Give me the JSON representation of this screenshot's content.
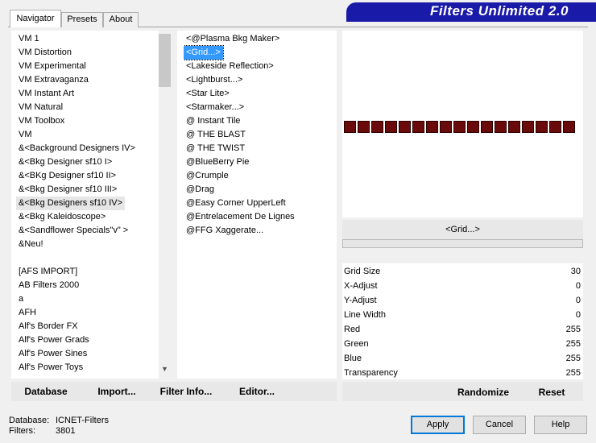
{
  "app": {
    "title": "Filters Unlimited 2.0"
  },
  "tabs": [
    {
      "label": "Navigator"
    },
    {
      "label": "Presets"
    },
    {
      "label": "About"
    }
  ],
  "categories": [
    "VM 1",
    "VM Distortion",
    "VM Experimental",
    "VM Extravaganza",
    "VM Instant Art",
    "VM Natural",
    "VM Toolbox",
    "VM",
    "&<Background Designers IV>",
    "&<Bkg Designer sf10 I>",
    "&<BKg Designer sf10 II>",
    "&<Bkg Designer sf10 III>",
    "&<Bkg Designers sf10 IV>",
    "&<Bkg Kaleidoscope>",
    "&<Sandflower Specials\"v\" >",
    "&Neu!",
    "",
    "[AFS IMPORT]",
    "AB Filters 2000",
    "a",
    "AFH",
    "Alf's Border FX",
    "Alf's Power Grads",
    "Alf's Power Sines",
    "Alf's Power Toys"
  ],
  "filters": [
    "<@Plasma Bkg Maker>",
    "<Grid...>",
    "<Lakeside Reflection>",
    "<Lightburst...>",
    "<Star Lite>",
    "<Starmaker...>",
    "@ Instant Tile",
    "@ THE BLAST",
    "@ THE TWIST",
    "@BlueBerry Pie",
    "@Crumple",
    "@Drag",
    "@Easy Corner UpperLeft",
    "@Entrelacement De Lignes",
    "@FFG Xaggerate..."
  ],
  "preview": {
    "filter_name": "<Grid...>",
    "grid_color": "#6b0a0a",
    "cell_count": 17
  },
  "params": [
    {
      "label": "Grid Size",
      "value": "30"
    },
    {
      "label": "X-Adjust",
      "value": "0"
    },
    {
      "label": "Y-Adjust",
      "value": "0"
    },
    {
      "label": "Line Width",
      "value": "0"
    },
    {
      "label": "Red",
      "value": "255"
    },
    {
      "label": "Green",
      "value": "255"
    },
    {
      "label": "Blue",
      "value": "255"
    },
    {
      "label": "Transparency",
      "value": "255"
    }
  ],
  "toolbar": {
    "database": "Database",
    "import": "Import...",
    "filter_info": "Filter Info...",
    "editor": "Editor...",
    "randomize": "Randomize",
    "reset": "Reset"
  },
  "status": {
    "database_label": "Database:",
    "database_value": "ICNET-Filters",
    "filters_label": "Filters:",
    "filters_value": "3801"
  },
  "buttons": {
    "apply": "Apply",
    "cancel": "Cancel",
    "help": "Help"
  },
  "colors": {
    "banner": "#1a1aa8",
    "selection": "#3399ff",
    "grid": "#6b0a0a"
  }
}
